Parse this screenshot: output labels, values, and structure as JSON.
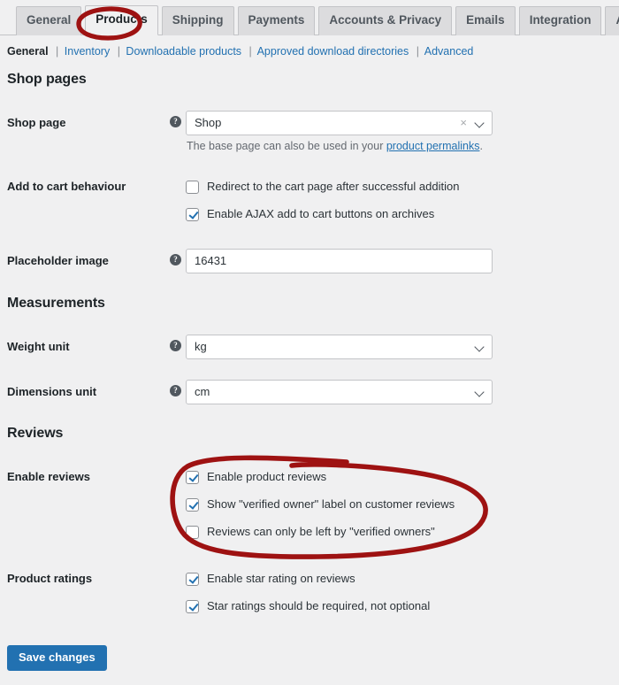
{
  "tabs": [
    {
      "label": "General",
      "active": false
    },
    {
      "label": "Products",
      "active": true
    },
    {
      "label": "Shipping",
      "active": false
    },
    {
      "label": "Payments",
      "active": false
    },
    {
      "label": "Accounts & Privacy",
      "active": false
    },
    {
      "label": "Emails",
      "active": false
    },
    {
      "label": "Integration",
      "active": false
    },
    {
      "label": "Advanced",
      "active": false
    }
  ],
  "subnav": {
    "items": [
      {
        "label": "General",
        "current": true
      },
      {
        "label": "Inventory",
        "current": false
      },
      {
        "label": "Downloadable products",
        "current": false
      },
      {
        "label": "Approved download directories",
        "current": false
      },
      {
        "label": "Advanced",
        "current": false
      }
    ],
    "separator": "|"
  },
  "sections": {
    "shop_pages": {
      "title": "Shop pages",
      "shop_page": {
        "label": "Shop page",
        "value": "Shop",
        "help": "?",
        "clear": "×",
        "description_prefix": "The base page can also be used in your ",
        "description_link": "product permalinks",
        "description_suffix": "."
      },
      "add_to_cart": {
        "label": "Add to cart behaviour",
        "options": [
          {
            "label": "Redirect to the cart page after successful addition",
            "checked": false
          },
          {
            "label": "Enable AJAX add to cart buttons on archives",
            "checked": true
          }
        ]
      },
      "placeholder_image": {
        "label": "Placeholder image",
        "value": "16431",
        "help": "?"
      }
    },
    "measurements": {
      "title": "Measurements",
      "weight_unit": {
        "label": "Weight unit",
        "value": "kg",
        "help": "?"
      },
      "dimensions_unit": {
        "label": "Dimensions unit",
        "value": "cm",
        "help": "?"
      }
    },
    "reviews": {
      "title": "Reviews",
      "enable_reviews": {
        "label": "Enable reviews",
        "options": [
          {
            "label": "Enable product reviews",
            "checked": true
          },
          {
            "label": "Show \"verified owner\" label on customer reviews",
            "checked": true
          },
          {
            "label": "Reviews can only be left by \"verified owners\"",
            "checked": false
          }
        ]
      },
      "product_ratings": {
        "label": "Product ratings",
        "options": [
          {
            "label": "Enable star rating on reviews",
            "checked": true
          },
          {
            "label": "Star ratings should be required, not optional",
            "checked": true
          }
        ]
      }
    }
  },
  "footer": {
    "save_label": "Save changes"
  },
  "annotations": {
    "color": "#9e1212",
    "marks": [
      {
        "name": "products-tab-circle",
        "shape": "ellipse"
      },
      {
        "name": "enable-reviews-circle",
        "shape": "ellipse"
      }
    ]
  },
  "colors": {
    "background": "#f0f0f1",
    "accent": "#2271b1",
    "link": "#2271b1",
    "annotation": "#9e1212",
    "tab_inactive": "#dcdcde",
    "text": "#1d2327"
  }
}
